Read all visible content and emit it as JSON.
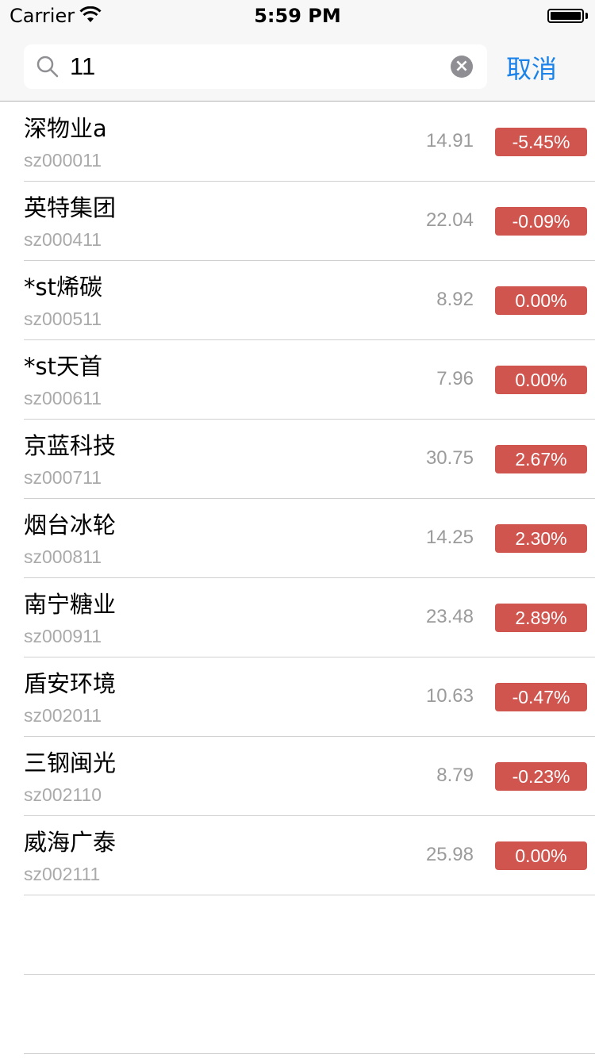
{
  "status_bar": {
    "carrier": "Carrier",
    "time": "5:59 PM"
  },
  "search": {
    "query": "11",
    "cancel_label": "取消"
  },
  "colors": {
    "accent": "#1a82e8",
    "badge": "#d0554f"
  },
  "stocks": [
    {
      "name": "深物业a",
      "code": "sz000011",
      "price": "14.91",
      "change": "-5.45%"
    },
    {
      "name": "英特集团",
      "code": "sz000411",
      "price": "22.04",
      "change": "-0.09%"
    },
    {
      "name": "*st烯碳",
      "code": "sz000511",
      "price": "8.92",
      "change": "0.00%"
    },
    {
      "name": "*st天首",
      "code": "sz000611",
      "price": "7.96",
      "change": "0.00%"
    },
    {
      "name": "京蓝科技",
      "code": "sz000711",
      "price": "30.75",
      "change": "2.67%"
    },
    {
      "name": "烟台冰轮",
      "code": "sz000811",
      "price": "14.25",
      "change": "2.30%"
    },
    {
      "name": "南宁糖业",
      "code": "sz000911",
      "price": "23.48",
      "change": "2.89%"
    },
    {
      "name": "盾安环境",
      "code": "sz002011",
      "price": "10.63",
      "change": "-0.47%"
    },
    {
      "name": "三钢闽光",
      "code": "sz002110",
      "price": "8.79",
      "change": "-0.23%"
    },
    {
      "name": "威海广泰",
      "code": "sz002111",
      "price": "25.98",
      "change": "0.00%"
    }
  ]
}
